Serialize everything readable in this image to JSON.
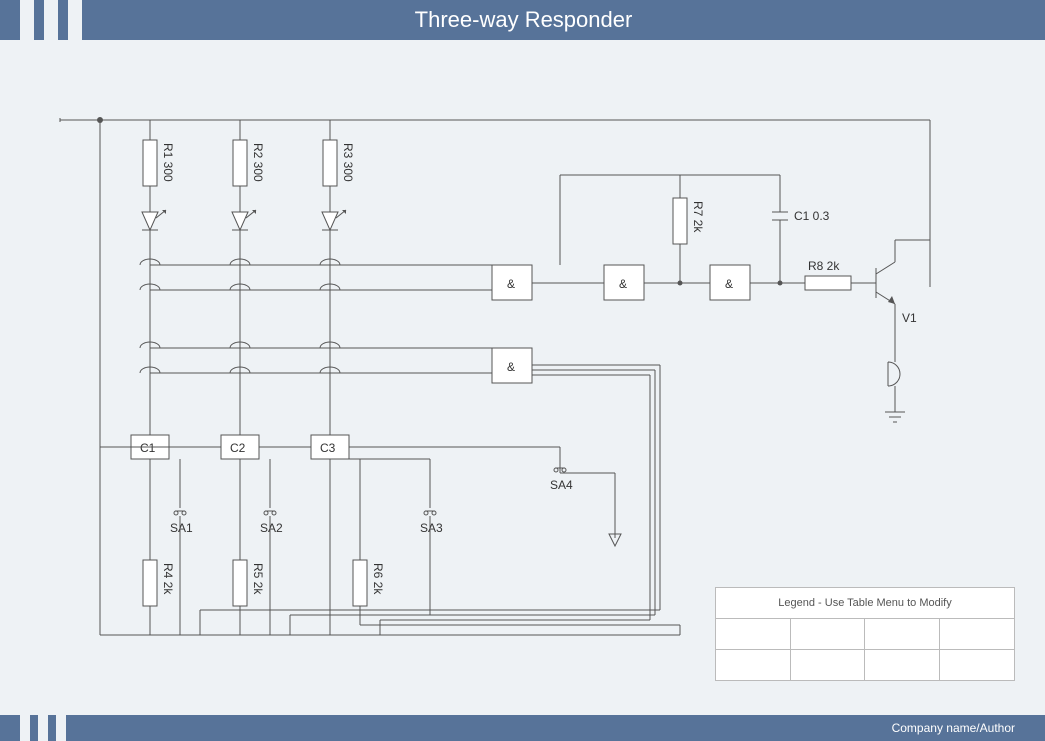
{
  "header": {
    "title": "Three-way Responder"
  },
  "footer": {
    "label": "Company name/Author"
  },
  "components": {
    "r1": "R1 300",
    "r2": "R2 300",
    "r3": "R3 300",
    "r4": "R4 2k",
    "r5": "R5 2k",
    "r6": "R6 2k",
    "r7": "R7 2k",
    "r8": "R8 2k",
    "c1": "C1",
    "c2": "C2",
    "c3": "C3",
    "cap1": "C1 0.3",
    "sa1": "SA1",
    "sa2": "SA2",
    "sa3": "SA3",
    "sa4": "SA4",
    "v1": "V1",
    "gate": "&"
  },
  "legend": {
    "title": "Legend - Use Table Menu to Modify"
  }
}
